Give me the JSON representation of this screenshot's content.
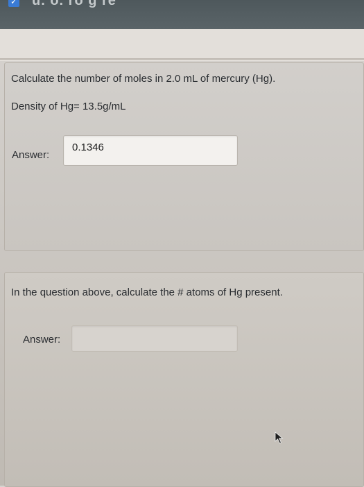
{
  "header": {
    "partial_title": "u. o. ro g re"
  },
  "question1": {
    "line1": "Calculate the number of moles in 2.0 mL of mercury (Hg).",
    "line2": "Density of Hg= 13.5g/mL",
    "answer_label": "Answer:",
    "answer_value": "0.1346"
  },
  "question2": {
    "text": "In the question above, calculate the # atoms of Hg present.",
    "answer_label": "Answer:",
    "answer_value": ""
  },
  "icons": {
    "top_check": "checkbox-icon",
    "cursor": "mouse-pointer-icon"
  },
  "colors": {
    "panel": "#cdc9c4",
    "input_active": "#f3f1ee",
    "top_strip": "#525c60"
  }
}
